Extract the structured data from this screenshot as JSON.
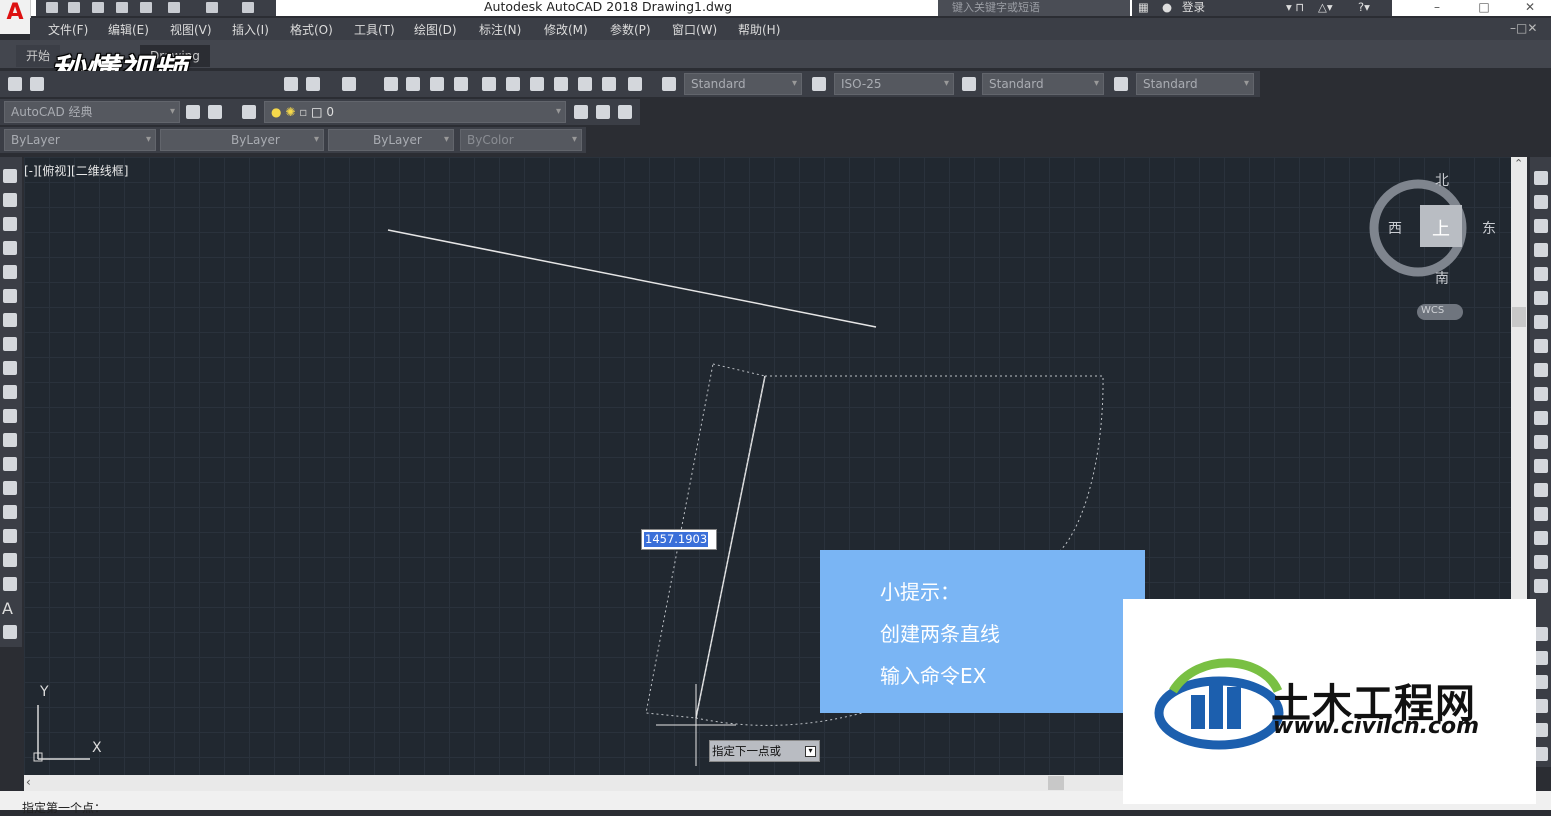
{
  "window": {
    "title": "Autodesk AutoCAD 2018   Drawing1.dwg",
    "search_placeholder": "键入关键字或短语",
    "login_label": "登录",
    "app_letter": "A"
  },
  "menu": [
    "文件(F)",
    "编辑(E)",
    "视图(V)",
    "插入(I)",
    "格式(O)",
    "工具(T)",
    "绘图(D)",
    "标注(N)",
    "修改(M)",
    "参数(P)",
    "窗口(W)",
    "帮助(H)"
  ],
  "tabs": {
    "start": "开始",
    "drawing": "Drawing"
  },
  "watermark_top": "秒懂视频",
  "styles": {
    "text_style": "Standard",
    "dim_style": "ISO-25",
    "table_style": "Standard",
    "mleader_style": "Standard"
  },
  "workspace": "AutoCAD 经典",
  "layer": "0",
  "properties": {
    "color": "ByLayer",
    "linetype": "ByLayer",
    "lineweight": "ByLayer",
    "plotstyle": "ByColor"
  },
  "viewport_label": "[-][俯视][二维线框]",
  "viewcube": {
    "north": "北",
    "south": "南",
    "east": "东",
    "west": "西",
    "top": "上",
    "wcs": "WCS"
  },
  "ucs": {
    "x": "X",
    "y": "Y"
  },
  "dynamic_input": {
    "value": "1457.1903",
    "prompt": "指定下一点或"
  },
  "tip": {
    "title": "小提示：",
    "line1": "创建两条直线",
    "line2": "输入命令EX"
  },
  "command_line": "指定第一个点：",
  "brand": {
    "name": "土木工程网",
    "url": "www.civilcn.com"
  },
  "colors": {
    "canvas": "#212830",
    "tip_bg": "#7ab5f4",
    "selection": "#3a6fd9"
  }
}
